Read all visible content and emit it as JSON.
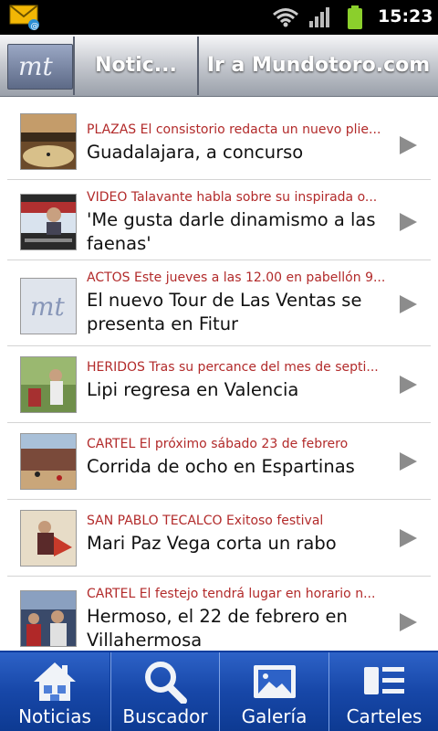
{
  "status": {
    "time": "15:23"
  },
  "header": {
    "logo_text": "mt",
    "tab_news": "Notic...",
    "tab_site": "Ir a Mundotoro.com"
  },
  "news": [
    {
      "kicker": "PLAZAS El consistorio redacta un nuevo plie...",
      "title": "Guadalajara, a concurso",
      "thumb": "bullring-photo"
    },
    {
      "kicker": "VIDEO Talavante habla sobre su inspirada o...",
      "title": "'Me gusta darle dinamismo a las faenas'",
      "thumb": "video-photo"
    },
    {
      "kicker": "ACTOS Este jueves a las 12.00 en pabellón 9...",
      "title": "El nuevo Tour de Las Ventas se presenta en Fitur",
      "thumb": "mt-logo"
    },
    {
      "kicker": "HERIDOS Tras su percance del mes de septi...",
      "title": "Lipi regresa en Valencia",
      "thumb": "bullfighter-photo"
    },
    {
      "kicker": "CARTEL El próximo sábado 23 de febrero",
      "title": "Corrida de ocho en Espartinas",
      "thumb": "crowd-photo"
    },
    {
      "kicker": "SAN PABLO TECALCO Exitoso festival",
      "title": "Mari Paz Vega corta un rabo",
      "thumb": "bullfighter-photo"
    },
    {
      "kicker": "CARTEL El festejo tendrá lugar en horario n...",
      "title": "Hermoso, el 22 de febrero en Villahermosa",
      "thumb": "crowd-photo"
    }
  ],
  "nav": [
    {
      "label": "Noticias",
      "icon": "home-icon"
    },
    {
      "label": "Buscador",
      "icon": "search-icon"
    },
    {
      "label": "Galería",
      "icon": "image-icon"
    },
    {
      "label": "Carteles",
      "icon": "list-icon"
    }
  ],
  "colors": {
    "kicker": "#b22a2a",
    "nav_bg": "#1747a8"
  }
}
